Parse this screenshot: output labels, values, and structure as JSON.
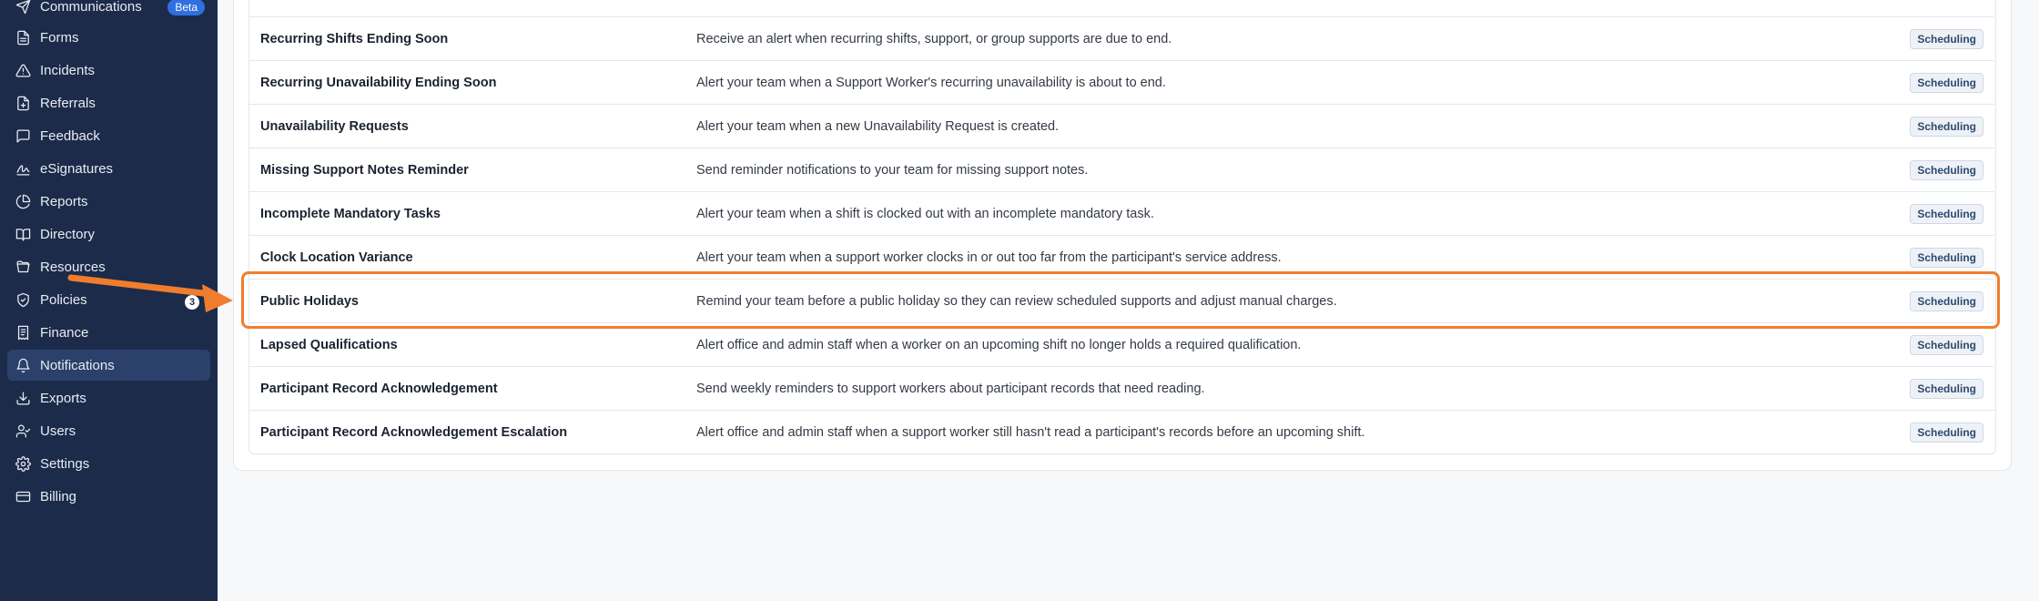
{
  "sidebar": {
    "items": [
      {
        "label": "Communications",
        "icon": "send-icon",
        "badge": "Beta"
      },
      {
        "label": "Forms",
        "icon": "file-text-icon"
      },
      {
        "label": "Incidents",
        "icon": "alert-triangle-icon"
      },
      {
        "label": "Referrals",
        "icon": "file-plus-icon"
      },
      {
        "label": "Feedback",
        "icon": "message-square-icon"
      },
      {
        "label": "eSignatures",
        "icon": "signature-icon"
      },
      {
        "label": "Reports",
        "icon": "pie-chart-icon"
      },
      {
        "label": "Directory",
        "icon": "book-open-icon"
      },
      {
        "label": "Resources",
        "icon": "folder-open-icon"
      },
      {
        "label": "Policies",
        "icon": "shield-check-icon",
        "count": "3"
      },
      {
        "label": "Finance",
        "icon": "receipt-icon"
      },
      {
        "label": "Notifications",
        "icon": "bell-icon",
        "active": true
      },
      {
        "label": "Exports",
        "icon": "download-icon"
      },
      {
        "label": "Users",
        "icon": "users-icon"
      },
      {
        "label": "Settings",
        "icon": "gear-icon"
      },
      {
        "label": "Billing",
        "icon": "credit-card-icon"
      }
    ]
  },
  "notifications": {
    "rows": [
      {
        "name": "Recurring Shifts Ending Soon",
        "description": "Receive an alert when recurring shifts, support, or group supports are due to end.",
        "category": "Scheduling"
      },
      {
        "name": "Recurring Unavailability Ending Soon",
        "description": "Alert your team when a Support Worker's recurring unavailability is about to end.",
        "category": "Scheduling"
      },
      {
        "name": "Unavailability Requests",
        "description": "Alert your team when a new Unavailability Request is created.",
        "category": "Scheduling"
      },
      {
        "name": "Missing Support Notes Reminder",
        "description": "Send reminder notifications to your team for missing support notes.",
        "category": "Scheduling"
      },
      {
        "name": "Incomplete Mandatory Tasks",
        "description": "Alert your team when a shift is clocked out with an incomplete mandatory task.",
        "category": "Scheduling"
      },
      {
        "name": "Clock Location Variance",
        "description": "Alert your team when a support worker clocks in or out too far from the participant's service address.",
        "category": "Scheduling"
      },
      {
        "name": "Public Holidays",
        "description": "Remind your team before a public holiday so they can review scheduled supports and adjust manual charges.",
        "category": "Scheduling"
      },
      {
        "name": "Lapsed Qualifications",
        "description": "Alert office and admin staff when a worker on an upcoming shift no longer holds a required qualification.",
        "category": "Scheduling"
      },
      {
        "name": "Participant Record Acknowledgement",
        "description": "Send weekly reminders to support workers about participant records that need reading.",
        "category": "Scheduling"
      },
      {
        "name": "Participant Record Acknowledgement Escalation",
        "description": "Alert office and admin staff when a support worker still hasn't read a participant's records before an upcoming shift.",
        "category": "Scheduling"
      }
    ]
  },
  "colors": {
    "sidebar": "#1c2b4a",
    "accent": "#f07d2e",
    "active": "#2b416b"
  }
}
